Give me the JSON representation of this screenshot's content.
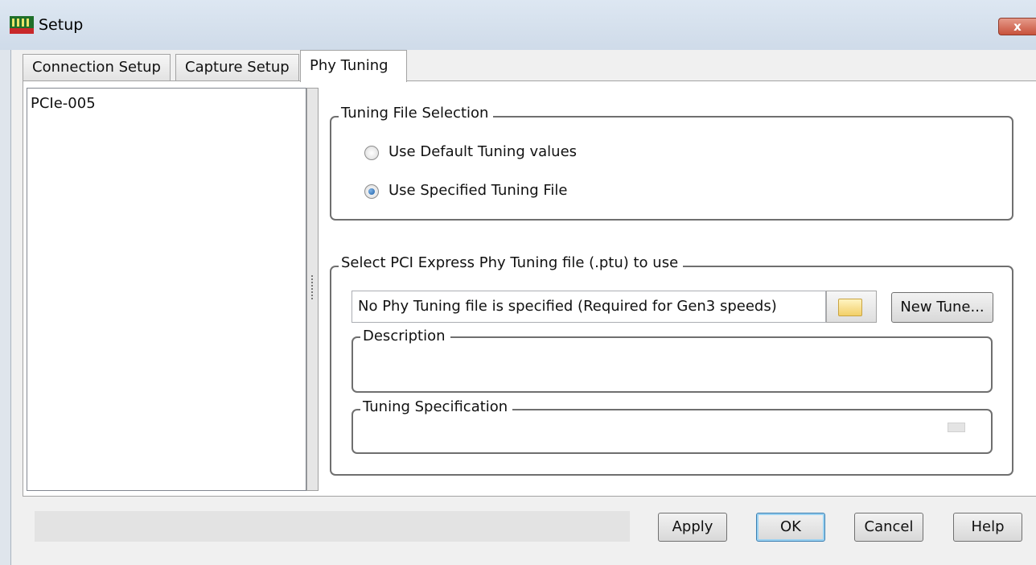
{
  "window": {
    "title": "Setup",
    "close_label": "x"
  },
  "tabs": [
    {
      "label": "Connection Setup",
      "active": false
    },
    {
      "label": "Capture Setup",
      "active": false
    },
    {
      "label": "Phy Tuning",
      "active": true
    }
  ],
  "device_list": {
    "items": [
      "PCIe-005"
    ]
  },
  "tuning_file_selection": {
    "label": "Tuning File Selection",
    "options": [
      {
        "label": "Use Default Tuning values",
        "selected": false
      },
      {
        "label": "Use Specified Tuning File",
        "selected": true
      }
    ]
  },
  "ptu_file": {
    "label": "Select PCI Express Phy Tuning file (.ptu) to use",
    "field_value": "No Phy Tuning file is specified (Required for Gen3 speeds)",
    "browse_icon": "folder-icon",
    "new_tune_label": "New Tune...",
    "description_label": "Description",
    "description_value": "",
    "tuning_spec_label": "Tuning Specification",
    "tuning_spec_value": ""
  },
  "footer": {
    "status_text": "",
    "buttons": {
      "apply": "Apply",
      "ok": "OK",
      "cancel": "Cancel",
      "help": "Help"
    }
  },
  "colors": {
    "titlebar": "#d6e1ee",
    "close_button": "#c8523c",
    "selected_radio": "#1d5fa8",
    "default_button_glow": "#9ad2f2"
  }
}
